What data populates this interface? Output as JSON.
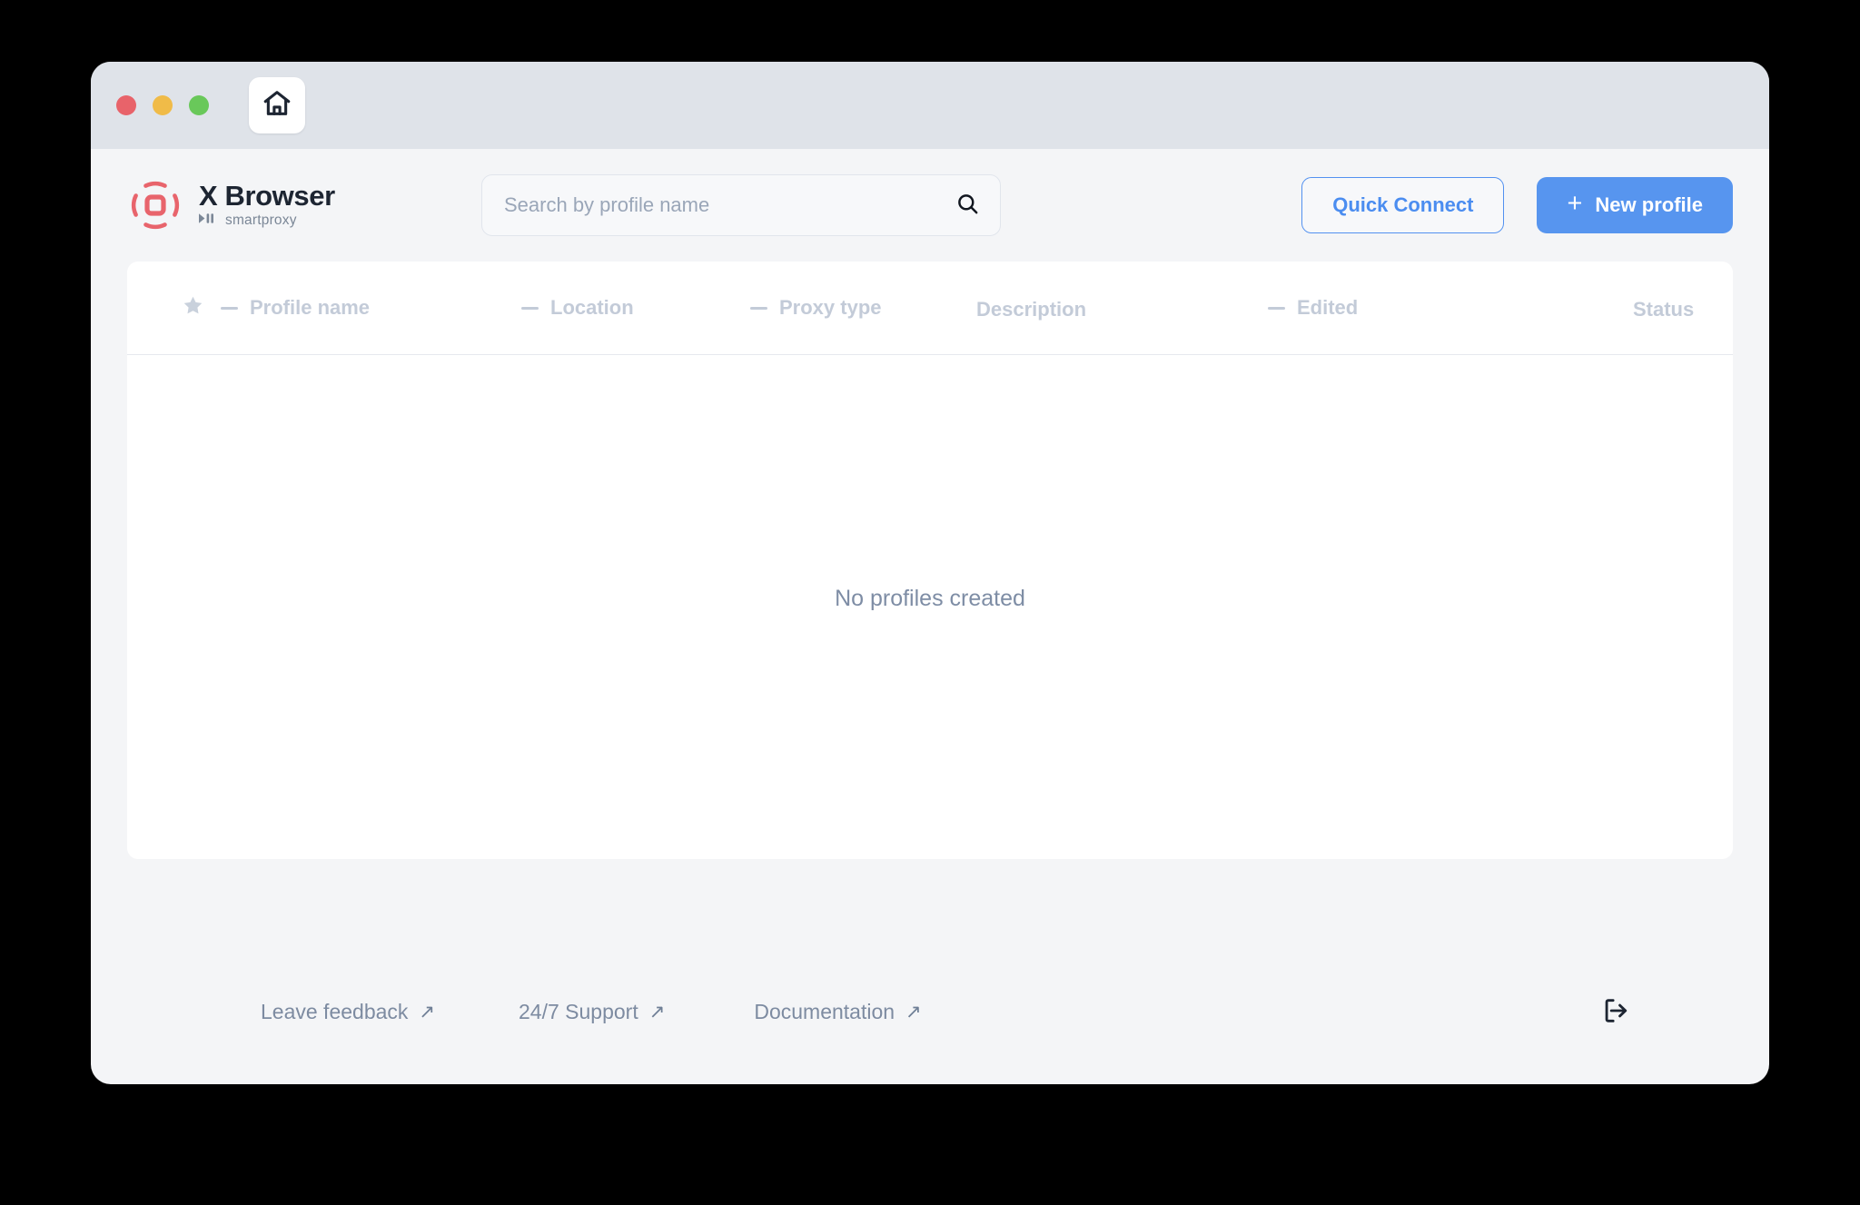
{
  "window": {
    "traffic_lights": [
      {
        "name": "close",
        "color": "#e8636a"
      },
      {
        "name": "minimize",
        "color": "#f0bb48"
      },
      {
        "name": "maximize",
        "color": "#69c85a"
      }
    ],
    "home_tab_icon": "home-icon"
  },
  "brand": {
    "title": "X Browser",
    "subtitle": "smartproxy",
    "logo_icon": "x-browser-logo-icon",
    "logo_color": "#e8646c",
    "title_color": "#1d2532",
    "subtitle_color": "#7b8797"
  },
  "search": {
    "placeholder": "Search by profile name",
    "value": "",
    "icon": "search-icon"
  },
  "actions": {
    "quick_connect_label": "Quick Connect",
    "new_profile_label": "New profile",
    "new_profile_plus": "+",
    "accent_color": "#5795ef",
    "outline_color": "#4b8df0"
  },
  "table": {
    "columns": [
      {
        "id": "star",
        "label": "",
        "icon": "star-icon",
        "sortable": false
      },
      {
        "id": "profile",
        "label": "Profile name",
        "sortable": true
      },
      {
        "id": "location",
        "label": "Location",
        "sortable": true
      },
      {
        "id": "proxy_type",
        "label": "Proxy type",
        "sortable": true
      },
      {
        "id": "description",
        "label": "Description",
        "sortable": false
      },
      {
        "id": "edited",
        "label": "Edited",
        "sortable": true
      },
      {
        "id": "status",
        "label": "Status",
        "sortable": false
      }
    ],
    "rows": [],
    "empty_message": "No profiles created",
    "header_color": "#c3cbd8",
    "empty_color": "#7e8da5"
  },
  "footer": {
    "links": [
      {
        "label": "Leave feedback",
        "icon": "external-link-arrow-icon"
      },
      {
        "label": "24/7 Support",
        "icon": "external-link-arrow-icon"
      },
      {
        "label": "Documentation",
        "icon": "external-link-arrow-icon"
      }
    ],
    "arrow_glyph": "↗",
    "logout_icon": "logout-icon",
    "link_color": "#7d8ba1"
  }
}
